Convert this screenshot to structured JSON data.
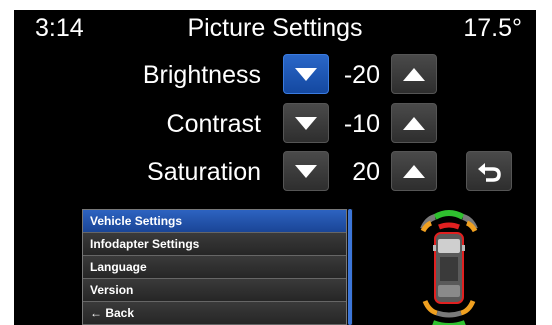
{
  "status": {
    "time": "3:14",
    "title": "Picture Settings",
    "temperature": "17.5°"
  },
  "settings": [
    {
      "label": "Brightness",
      "value": "-20"
    },
    {
      "label": "Contrast",
      "value": "-10"
    },
    {
      "label": "Saturation",
      "value": "20"
    }
  ],
  "icons": {
    "decrease": "triangle-down-icon",
    "increase": "triangle-up-icon",
    "back": "back-arrow-icon",
    "vehicle": "parking-sensor-car-icon"
  },
  "menu": {
    "items": [
      {
        "label": "Vehicle Settings",
        "selected": true
      },
      {
        "label": "Infodapter Settings",
        "selected": false
      },
      {
        "label": "Language",
        "selected": false
      },
      {
        "label": "Version",
        "selected": false
      },
      {
        "label": "← Back",
        "selected": false
      }
    ]
  },
  "colors": {
    "background": "#000000",
    "highlight": "#1f56b0",
    "sensor_green": "#2fc12f",
    "sensor_orange": "#f0a020",
    "sensor_red": "#e02020"
  }
}
